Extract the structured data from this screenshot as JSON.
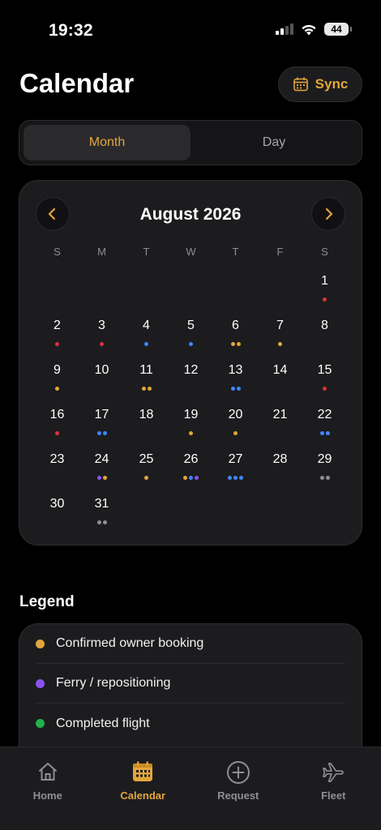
{
  "status_bar": {
    "time": "19:32",
    "battery": "44"
  },
  "header": {
    "title": "Calendar",
    "sync_label": "Sync"
  },
  "view_toggle": {
    "options": [
      "Month",
      "Day"
    ],
    "selected": "Month"
  },
  "calendar": {
    "month_label": "August 2026",
    "weekdays": [
      "S",
      "M",
      "T",
      "W",
      "T",
      "F",
      "S"
    ],
    "leading_blank_days": 6,
    "days": [
      {
        "day": "1",
        "events": [
          "red"
        ]
      },
      {
        "day": "2",
        "events": [
          "red"
        ]
      },
      {
        "day": "3",
        "events": [
          "red"
        ]
      },
      {
        "day": "4",
        "events": [
          "blue"
        ]
      },
      {
        "day": "5",
        "events": [
          "blue"
        ]
      },
      {
        "day": "6",
        "events": [
          "orange",
          "orange"
        ]
      },
      {
        "day": "7",
        "events": [
          "orange"
        ]
      },
      {
        "day": "8",
        "events": []
      },
      {
        "day": "9",
        "events": [
          "orange"
        ]
      },
      {
        "day": "10",
        "events": []
      },
      {
        "day": "11",
        "events": [
          "orange",
          "orange"
        ]
      },
      {
        "day": "12",
        "events": []
      },
      {
        "day": "13",
        "events": [
          "blue",
          "blue"
        ]
      },
      {
        "day": "14",
        "events": []
      },
      {
        "day": "15",
        "events": [
          "red"
        ]
      },
      {
        "day": "16",
        "events": [
          "red"
        ]
      },
      {
        "day": "17",
        "events": [
          "blue",
          "blue"
        ]
      },
      {
        "day": "18",
        "events": []
      },
      {
        "day": "19",
        "events": [
          "orange"
        ]
      },
      {
        "day": "20",
        "events": [
          "orange"
        ]
      },
      {
        "day": "21",
        "events": []
      },
      {
        "day": "22",
        "events": [
          "blue",
          "blue"
        ]
      },
      {
        "day": "23",
        "events": []
      },
      {
        "day": "24",
        "events": [
          "purple",
          "orange"
        ]
      },
      {
        "day": "25",
        "events": [
          "orange"
        ]
      },
      {
        "day": "26",
        "events": [
          "orange",
          "blue",
          "purple"
        ]
      },
      {
        "day": "27",
        "events": [
          "blue",
          "blue",
          "blue"
        ]
      },
      {
        "day": "28",
        "events": []
      },
      {
        "day": "29",
        "events": [
          "gray",
          "gray"
        ]
      },
      {
        "day": "30",
        "events": []
      },
      {
        "day": "31",
        "events": [
          "gray",
          "gray"
        ]
      }
    ]
  },
  "event_colors": {
    "red": "#e0303f",
    "blue": "#3f86ff",
    "orange": "#e3a63a",
    "purple": "#8a52f0",
    "gray": "#8e8e93"
  },
  "legend": {
    "title": "Legend",
    "items": [
      {
        "label": "Confirmed owner booking",
        "color": "#e3a63a"
      },
      {
        "label": "Ferry / repositioning",
        "color": "#8a52f0"
      },
      {
        "label": "Completed flight",
        "color": "#22b04a"
      }
    ]
  },
  "tab_bar": {
    "items": [
      {
        "label": "Home",
        "icon": "home-icon"
      },
      {
        "label": "Calendar",
        "icon": "calendar-icon"
      },
      {
        "label": "Request",
        "icon": "plus-circle-icon"
      },
      {
        "label": "Fleet",
        "icon": "airplane-icon"
      }
    ],
    "active": "Calendar"
  },
  "theme": {
    "accent": "#e3a63a",
    "background": "#000000",
    "card": "#1c1c1e"
  }
}
